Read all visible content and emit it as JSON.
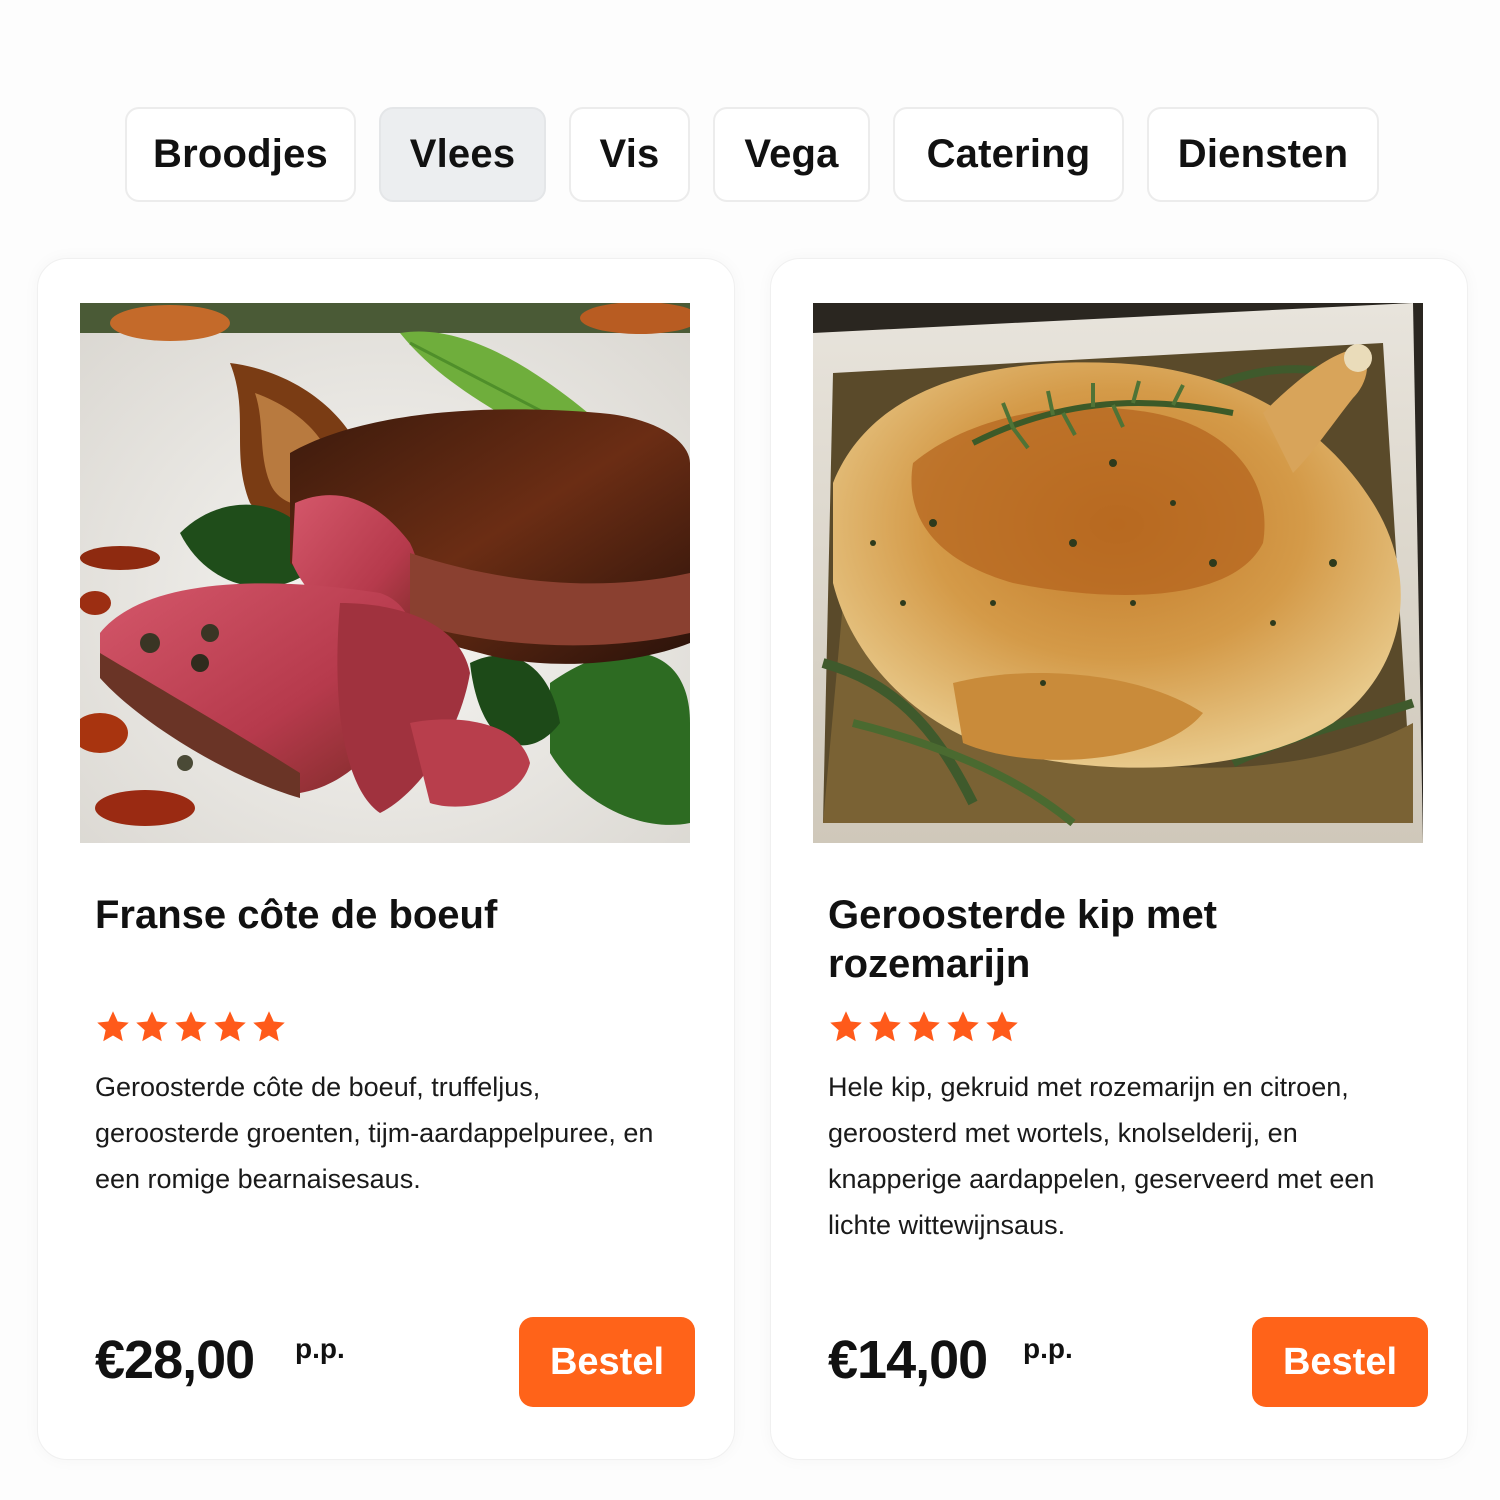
{
  "categories": {
    "items": [
      "Broodjes",
      "Vlees",
      "Vis",
      "Vega",
      "Catering",
      "Diensten"
    ],
    "active": "Vlees"
  },
  "products": [
    {
      "title": "Franse côte de boeuf",
      "image": "sliced-steak-photo",
      "rating": 5,
      "description": "Geroosterde côte de boeuf, truffeljus, geroosterde groenten, tijm-aardappelpuree, en een romige bearnaisesaus.",
      "price": "€28,00",
      "price_unit": "p.p.",
      "button_label": "Bestel"
    },
    {
      "title": "Geroosterde kip met rozemarijn",
      "image": "roast-chicken-photo",
      "rating": 5,
      "description": "Hele kip, gekruid met rozemarijn en citroen, geroosterd met wortels, knolselderij, en knapperige aardappelen, geserveerd met een lichte wittewijnsaus.",
      "price": "€14,00",
      "price_unit": "p.p.",
      "button_label": "Bestel"
    }
  ],
  "colors": {
    "accent": "#ff6319",
    "star": "#ff5a1a",
    "tab_active_bg": "#eceef0",
    "text": "#111111"
  }
}
